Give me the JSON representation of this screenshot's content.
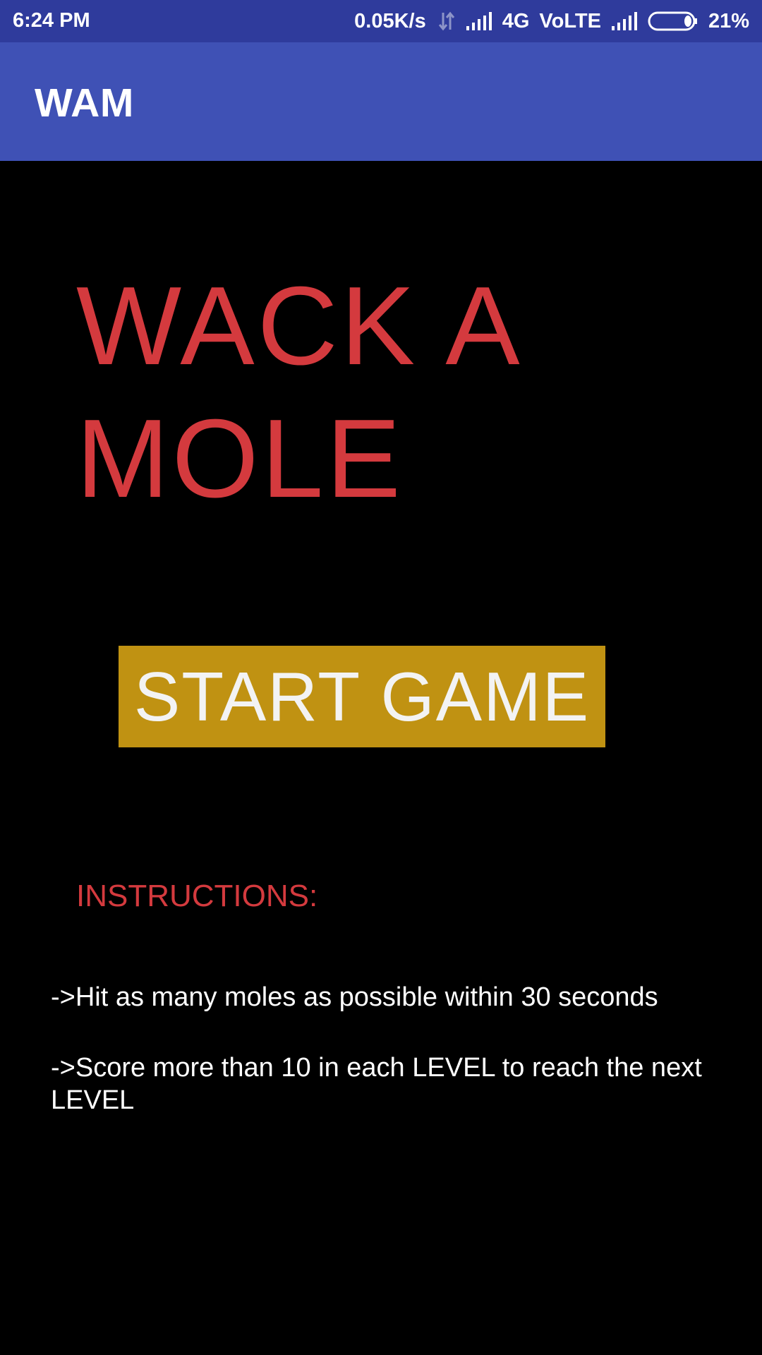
{
  "status_bar": {
    "time": "6:24 PM",
    "network_speed": "0.05K/s",
    "network_type": "4G",
    "volte": "VoLTE",
    "battery": "21%",
    "icons": [
      "data-arrows-icon",
      "signal-icon",
      "signal-icon",
      "battery-icon"
    ]
  },
  "app_bar": {
    "title": "WAM",
    "color": "#3f51b5"
  },
  "main": {
    "game_title": "WACK  A\nMOLE",
    "start_button_label": "START GAME",
    "instructions_heading": "INSTRUCTIONS:",
    "instructions": [
      "->Hit as many moles as possible within 30 seconds",
      "->Score more than 10 in each LEVEL to reach the next LEVEL"
    ]
  },
  "colors": {
    "title_red": "#d43a3e",
    "button_gold": "#c09212",
    "background": "#000000",
    "status_bar": "#2f3b9c"
  }
}
